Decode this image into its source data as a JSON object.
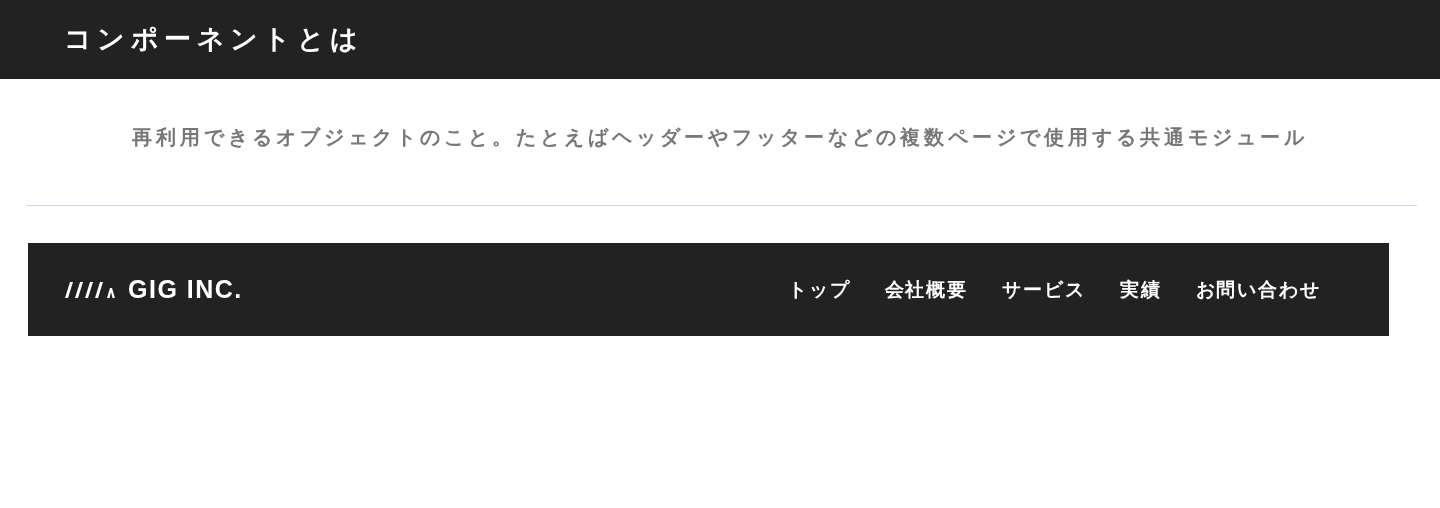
{
  "header": {
    "title": "コンポーネントとは"
  },
  "description": "再利用できるオブジェクトのこと。たとえばヘッダーやフッターなどの複数ページで使用する共通モジュール",
  "example_header": {
    "logo_text": "GIG INC.",
    "nav": [
      {
        "label": "トップ"
      },
      {
        "label": "会社概要"
      },
      {
        "label": "サービス"
      },
      {
        "label": "実績"
      },
      {
        "label": "お問い合わせ"
      }
    ]
  }
}
